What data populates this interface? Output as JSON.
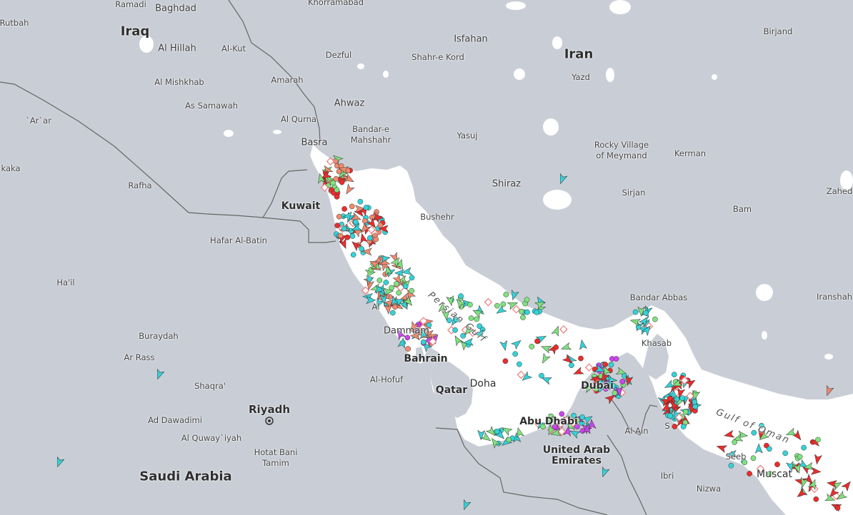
{
  "map": {
    "colors": {
      "land": "#c9ced6",
      "water": "#ffffff",
      "border": "#666666",
      "vessel_red": "#ee2b2b",
      "vessel_salmon": "#f08a6f",
      "vessel_cyan": "#33d3d8",
      "vessel_green": "#7fe27f",
      "vessel_magenta": "#cc44ee",
      "vessel_blue": "#2255ee",
      "vessel_pink_outline": "#ee7b7b"
    },
    "countries": {
      "iraq": "Iraq",
      "iran": "Iran",
      "saudi_arabia": "Saudi Arabia",
      "qatar": "Qatar",
      "uae_line1": "United Arab",
      "uae_line2": "Emirates"
    },
    "capitals": {
      "riyadh": "Riyadh",
      "kuwait": "Kuwait",
      "doha": "Doha",
      "bahrain": "Bahrain",
      "abu_dhabi": "Abu Dhabi",
      "dubai": "Dubai",
      "muscat": "Muscat"
    },
    "waters": {
      "persian_gulf": "Persian Gulf",
      "gulf_of_oman": "Gulf of Oman"
    },
    "cities": {
      "ramadi": "Ramadi",
      "baghdad": "Baghdad",
      "khorramabad": "Khorramabad",
      "rutbah": "Rutbah",
      "isfahan": "Isfahan",
      "birjand": "Birjand",
      "al_hillah": "Al Hillah",
      "al_kut": "Al-Kut",
      "dezful": "Dezful",
      "shahr_e_kord": "Shahr-e Kord",
      "yazd": "Yazd",
      "al_mishkhab": "Al Mishkhab",
      "amarah": "Amarah",
      "as_samawah": "As Samawah",
      "ahwaz": "Ahwaz",
      "ar_ar": "`Ar`ar",
      "al_qurna": "Al Qurna",
      "bandar_e_mahshahr_1": "Bandar-e",
      "bandar_e_mahshahr_2": "Mahshahr",
      "yasuj": "Yasuj",
      "basra": "Basra",
      "rocky_village_1": "Rocky Village",
      "rocky_village_2": "of Meymand",
      "kerman": "Kerman",
      "kaka": "kaka",
      "rafha": "Rafha",
      "shiraz": "Shiraz",
      "sirjan": "Sirjan",
      "zahedan": "Zahed",
      "bushehr": "Bushehr",
      "bam": "Bam",
      "hafar_al_batin": "Hafar Al-Batin",
      "hail": "Ha'il",
      "bandar_abbas": "Bandar Abbas",
      "iranshahr": "Iranshah",
      "al_khobar": "Al",
      "dammam": "Dammam",
      "buraydah": "Buraydah",
      "khasab": "Khasab",
      "ar_rass": "Ar Rass",
      "al_hofuf": "Al-Hofuf",
      "shaqra": "Shaqra'",
      "ad_dawadimi": "Ad Dawadimi",
      "al_quway_iyah": "Al Quway`iyah",
      "al_ain": "Al Ain",
      "seeb": "Seeb",
      "hotat_bani_tamim_1": "Hotat Bani",
      "hotat_bani_tamim_2": "Tamim",
      "ibri": "Ibri",
      "nizwa": "Nizwa",
      "sohar": "S"
    }
  }
}
